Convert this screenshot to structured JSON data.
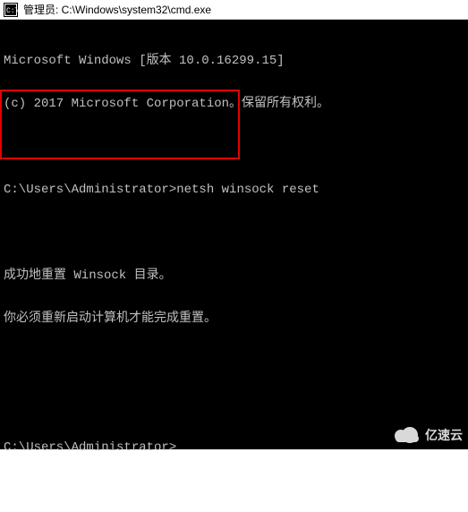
{
  "titlebar": {
    "text": "管理员: C:\\Windows\\system32\\cmd.exe"
  },
  "terminal": {
    "lines": [
      "Microsoft Windows [版本 10.0.16299.15]",
      "(c) 2017 Microsoft Corporation。保留所有权利。",
      "",
      "C:\\Users\\Administrator>netsh winsock reset",
      "",
      "成功地重置 Winsock 目录。",
      "你必须重新启动计算机才能完成重置。",
      "",
      "",
      "C:\\Users\\Administrator>"
    ],
    "command": "netsh winsock reset",
    "result_line1": "成功地重置 Winsock 目录。",
    "result_line2": "你必须重新启动计算机才能完成重置。",
    "prompt": "C:\\Users\\Administrator>"
  },
  "watermark": {
    "text": "亿速云"
  },
  "colors": {
    "highlight": "#e60000",
    "terminal_bg": "#000000",
    "terminal_fg": "#c0c0c0"
  }
}
